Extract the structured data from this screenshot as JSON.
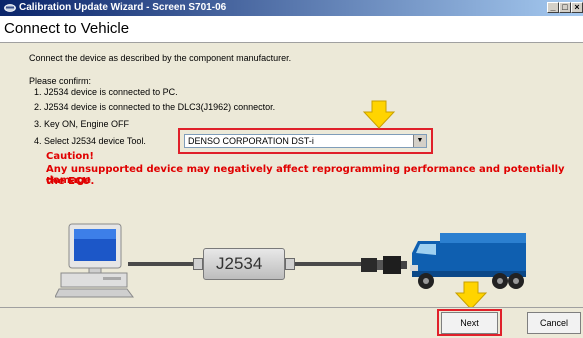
{
  "window": {
    "title": "Calibration Update Wizard - Screen S701-06"
  },
  "header": {
    "title": "Connect to Vehicle"
  },
  "main": {
    "instruction": "Connect the device as described by the component manufacturer.",
    "confirm_heading": "Please confirm:",
    "steps": [
      "1. J2534 device is connected to PC.",
      "2. J2534 device is connected to the DLC3(J1962) connector.",
      "3. Key ON, Engine OFF",
      "4. Select J2534 device Tool."
    ],
    "device_select": {
      "value": "DENSO CORPORATION  DST-i"
    },
    "caution_title": "Caution!",
    "caution_text_line1": "Any unsupported device may negatively affect reprogramming performance and potentially damage",
    "caution_text_line2": "the ECU.",
    "diagram_label": "J2534"
  },
  "buttons": {
    "next": "Next",
    "cancel": "Cancel"
  },
  "colors": {
    "accent_red": "#e0202a",
    "arrow_yellow": "#ffd400",
    "caution": "#e00000"
  }
}
